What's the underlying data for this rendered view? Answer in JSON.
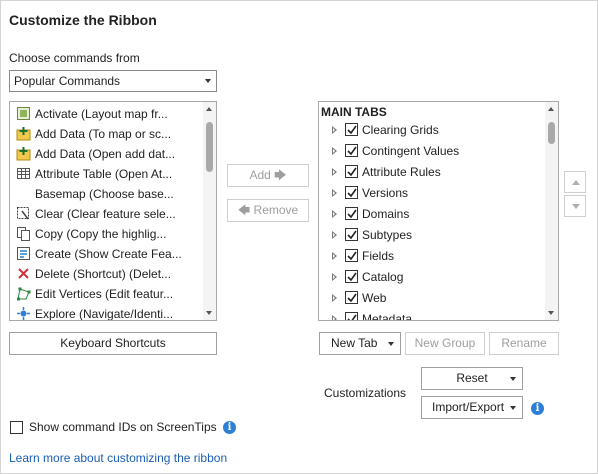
{
  "title": "Customize the Ribbon",
  "choose_label": "Choose commands from",
  "choose_select": "Popular Commands",
  "commands": [
    {
      "label": "Activate (Layout map fr...",
      "icon": "activate-icon"
    },
    {
      "label": "Add Data (To map or sc...",
      "icon": "add-data-icon"
    },
    {
      "label": "Add Data (Open add dat...",
      "icon": "add-data-icon"
    },
    {
      "label": "Attribute Table (Open At...",
      "icon": "table-icon"
    },
    {
      "label": "Basemap (Choose base...",
      "icon": "none"
    },
    {
      "label": "Clear (Clear feature sele...",
      "icon": "clear-selection-icon"
    },
    {
      "label": "Copy (Copy the highlig...",
      "icon": "copy-icon"
    },
    {
      "label": "Create (Show Create Fea...",
      "icon": "create-features-icon"
    },
    {
      "label": "Delete (Shortcut) (Delet...",
      "icon": "delete-icon"
    },
    {
      "label": "Edit Vertices (Edit featur...",
      "icon": "edit-vertices-icon"
    },
    {
      "label": "Explore (Navigate/Identi...",
      "icon": "explore-icon"
    }
  ],
  "buttons": {
    "add": "Add",
    "remove": "Remove",
    "keyboard_shortcuts": "Keyboard Shortcuts",
    "new_tab": "New Tab",
    "new_group": "New Group",
    "rename": "Rename",
    "reset": "Reset",
    "import_export": "Import/Export"
  },
  "tree": {
    "header": "MAIN TABS",
    "items": [
      {
        "label": "Clearing Grids",
        "checked": true
      },
      {
        "label": "Contingent Values",
        "checked": true
      },
      {
        "label": "Attribute Rules",
        "checked": true
      },
      {
        "label": "Versions",
        "checked": true
      },
      {
        "label": "Domains",
        "checked": true
      },
      {
        "label": "Subtypes",
        "checked": true
      },
      {
        "label": "Fields",
        "checked": true
      },
      {
        "label": "Catalog",
        "checked": true
      },
      {
        "label": "Web",
        "checked": true
      },
      {
        "label": "Metadata",
        "checked": true
      }
    ]
  },
  "customizations_label": "Customizations",
  "show_ids_label": "Show command IDs on ScreenTips",
  "learn_more_link": "Learn more about customizing the ribbon",
  "colors": {
    "accent": "#2c7fd4",
    "link": "#1a5fb4",
    "delete": "#d13438"
  }
}
